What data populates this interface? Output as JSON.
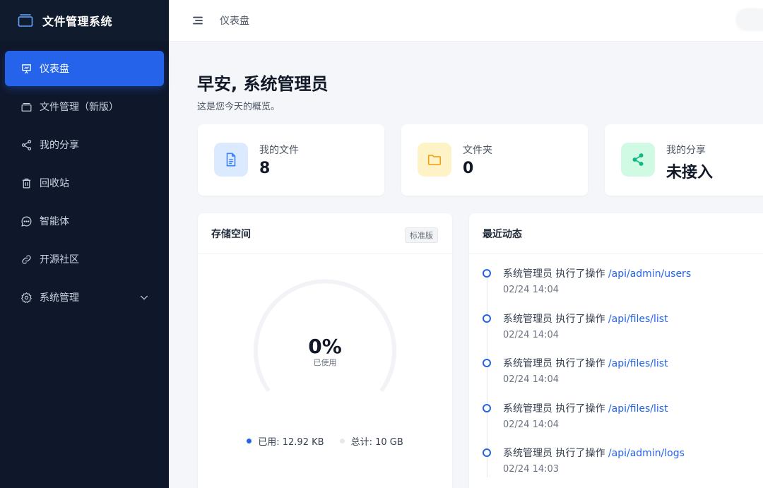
{
  "sidebar": {
    "brand": "文件管理系统",
    "items": [
      {
        "label": "仪表盘",
        "icon": "presentation-icon",
        "active": true
      },
      {
        "label": "文件管理（新版）",
        "icon": "folder-icon"
      },
      {
        "label": "我的分享",
        "icon": "share-icon"
      },
      {
        "label": "回收站",
        "icon": "trash-icon"
      },
      {
        "label": "智能体",
        "icon": "chat-icon"
      },
      {
        "label": "开源社区",
        "icon": "link-icon"
      },
      {
        "label": "系统管理",
        "icon": "gear-icon",
        "expandable": true
      }
    ]
  },
  "header": {
    "breadcrumb": "仪表盘"
  },
  "main": {
    "greeting": "早安, 系统管理员",
    "subtitle": "这是您今天的概览。",
    "stats": [
      {
        "label": "我的文件",
        "value": "8",
        "icon": "document-icon",
        "color": "#3b82f6"
      },
      {
        "label": "文件夹",
        "value": "0",
        "icon": "folder-icon",
        "color": "#f59e0b"
      },
      {
        "label": "我的分享",
        "value": "未接入",
        "icon": "share-icon",
        "color": "#10b981"
      }
    ],
    "storage": {
      "title": "存储空间",
      "plan": "标准版",
      "percent": "0%",
      "percent_value": 0,
      "caption": "已使用",
      "used": "已用: 12.92 KB",
      "total": "总计: 10 GB",
      "used_color": "#2563eb"
    },
    "activity": {
      "title": "最近动态",
      "items": [
        {
          "user": "系统管理员",
          "action": "执行了操作",
          "path": "/api/admin/users",
          "time": "02/24 14:04"
        },
        {
          "user": "系统管理员",
          "action": "执行了操作",
          "path": "/api/files/list",
          "time": "02/24 14:04"
        },
        {
          "user": "系统管理员",
          "action": "执行了操作",
          "path": "/api/files/list",
          "time": "02/24 14:04"
        },
        {
          "user": "系统管理员",
          "action": "执行了操作",
          "path": "/api/files/list",
          "time": "02/24 14:04"
        },
        {
          "user": "系统管理员",
          "action": "执行了操作",
          "path": "/api/admin/logs",
          "time": "02/24 14:03"
        }
      ]
    }
  }
}
